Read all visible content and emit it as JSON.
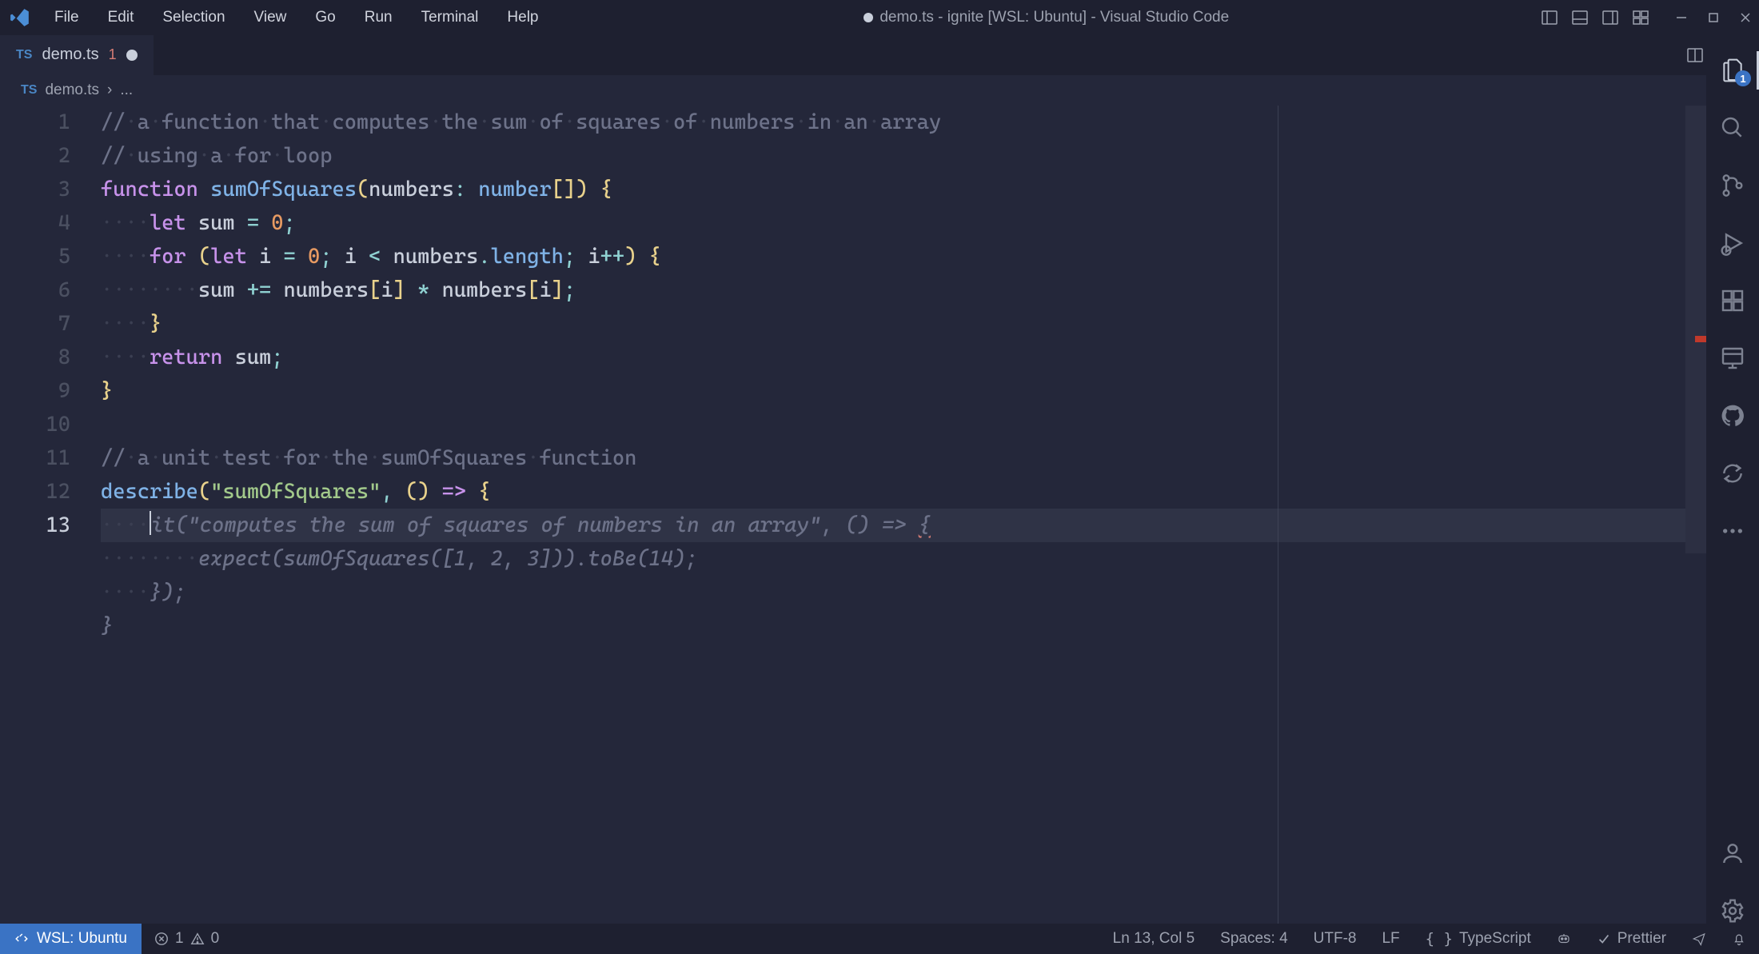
{
  "window": {
    "title_prefix_modified": true,
    "title": "demo.ts - ignite [WSL: Ubuntu] - Visual Studio Code"
  },
  "menubar": [
    "File",
    "Edit",
    "Selection",
    "View",
    "Go",
    "Run",
    "Terminal",
    "Help"
  ],
  "tab": {
    "icon": "TS",
    "filename": "demo.ts",
    "problem_count": "1",
    "modified": true
  },
  "breadcrumb": {
    "icon": "TS",
    "file": "demo.ts",
    "sep": "›",
    "tail": "..."
  },
  "editor": {
    "line_numbers": [
      "1",
      "2",
      "3",
      "4",
      "5",
      "6",
      "7",
      "8",
      "9",
      "10",
      "11",
      "12",
      "13"
    ],
    "current_line_index": 12,
    "lines_html": [
      "<span class='c-comment'>//<span class='c-white'>·</span>a<span class='c-white'>·</span>function<span class='c-white'>·</span>that<span class='c-white'>·</span>computes<span class='c-white'>·</span>the<span class='c-white'>·</span>sum<span class='c-white'>·</span>of<span class='c-white'>·</span>squares<span class='c-white'>·</span>of<span class='c-white'>·</span>numbers<span class='c-white'>·</span>in<span class='c-white'>·</span>an<span class='c-white'>·</span>array</span>",
      "<span class='c-comment'>//<span class='c-white'>·</span>using<span class='c-white'>·</span>a<span class='c-white'>·</span>for<span class='c-white'>·</span>loop</span>",
      "<span class='c-kw'>function</span> <span class='c-fn'>sumOfSquares</span><span class='c-paren'>(</span><span class='c-var'>numbers</span><span class='c-punc'>:</span> <span class='c-fn'>number</span><span class='c-paren'>[])</span> <span class='c-paren'>{</span>",
      "<span class='c-white'>····</span><span class='c-kw'>let</span> <span class='c-var'>sum</span> <span class='c-op'>=</span> <span class='c-num'>0</span><span class='c-punc'>;</span>",
      "<span class='c-white'>····</span><span class='c-kw'>for</span> <span class='c-paren'>(</span><span class='c-kw'>let</span> <span class='c-var'>i</span> <span class='c-op'>=</span> <span class='c-num'>0</span><span class='c-punc'>;</span> <span class='c-var'>i</span> <span class='c-op'>&lt;</span> <span class='c-var'>numbers</span><span class='c-punc'>.</span><span class='c-fn'>length</span><span class='c-punc'>;</span> <span class='c-var'>i</span><span class='c-op'>++</span><span class='c-paren'>)</span> <span class='c-paren'>{</span>",
      "<span class='c-white'>········</span><span class='c-var'>sum</span> <span class='c-op'>+=</span> <span class='c-var'>numbers</span><span class='c-paren'>[</span><span class='c-var'>i</span><span class='c-paren'>]</span> <span class='c-op'>*</span> <span class='c-var'>numbers</span><span class='c-paren'>[</span><span class='c-var'>i</span><span class='c-paren'>]</span><span class='c-punc'>;</span>",
      "<span class='c-white'>····</span><span class='c-paren'>}</span>",
      "<span class='c-white'>····</span><span class='c-kw'>return</span> <span class='c-var'>sum</span><span class='c-punc'>;</span>",
      "<span class='c-paren'>}</span>",
      "",
      "<span class='c-comment'>//<span class='c-white'>·</span>a<span class='c-white'>·</span>unit<span class='c-white'>·</span>test<span class='c-white'>·</span>for<span class='c-white'>·</span>the<span class='c-white'>·</span>sumOfSquares<span class='c-white'>·</span>function</span>",
      "<span class='c-fn'>describe</span><span class='c-paren'>(</span><span class='c-str'>\"sumOfSquares\"</span><span class='c-punc'>,</span> <span class='c-paren'>()</span> <span class='c-kw'>=&gt;</span> <span class='c-paren'>{</span>",
      "<span class='c-white'>····</span><span class='cursor-caret'></span><span class='c-ghost'>it(\"computes the sum of squares of numbers in an array\", () =&gt; <span class='squiggle'>{</span></span>",
      "<span class='c-white'>········</span><span class='c-ghost'>expect(sumOfSquares([1, 2, 3])).toBe(14);</span>",
      "<span class='c-white'>····</span><span class='c-ghost'>});</span>",
      "<span class='c-ghost'>}</span>"
    ]
  },
  "activitybar": {
    "explorer_badge": "1"
  },
  "statusbar": {
    "remote": "WSL: Ubuntu",
    "errors": "1",
    "warnings": "0",
    "cursor": "Ln 13, Col 5",
    "spaces": "Spaces: 4",
    "encoding": "UTF-8",
    "eol": "LF",
    "lang_prefix": "{ }",
    "lang": "TypeScript",
    "prettier": "Prettier"
  }
}
